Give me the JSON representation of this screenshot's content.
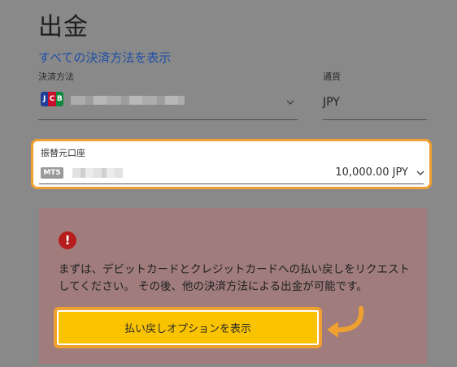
{
  "page": {
    "title": "出金",
    "all_methods_link": "すべての決済方法を表示"
  },
  "payment": {
    "method_label": "決済方法",
    "method_icon": "jcb-logo",
    "currency_label": "通貨",
    "currency_value": "JPY"
  },
  "account": {
    "label": "振替元口座",
    "platform_badge": "MT5",
    "balance": "10,000.00 JPY"
  },
  "notice": {
    "icon": "alert-icon",
    "message": "まずは、デビットカードとクレジットカードへの払い戻しをリクエストしてください。 その後、他の決済方法による出金が可能です。",
    "button_label": "払い戻しオプションを表示"
  },
  "colors": {
    "highlight": "#f0a030",
    "button": "#f9c300",
    "link": "#1f4fa8",
    "alert": "#b71d1d"
  }
}
